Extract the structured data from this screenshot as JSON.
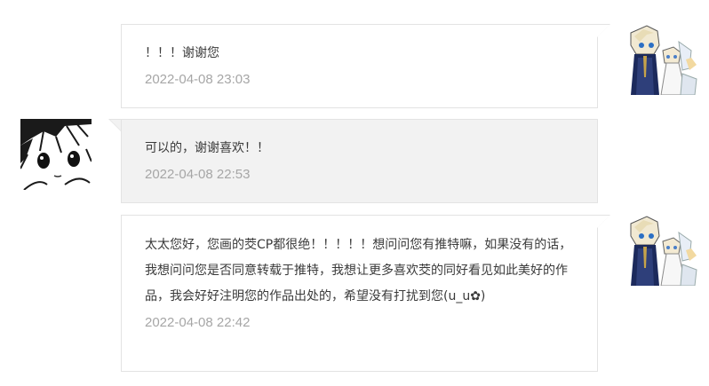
{
  "messages": [
    {
      "direction": "sent",
      "text": "！！！谢谢您",
      "timestamp": "2022-04-08 23:03"
    },
    {
      "direction": "received",
      "text": "可以的，谢谢喜欢！！",
      "timestamp": "2022-04-08 22:53"
    },
    {
      "direction": "sent",
      "text": "太太您好，您画的茭CP都很绝！！！！！想问问您有推特嘛，如果没有的话，我想问问您是否同意转载于推特，我想让更多喜欢茭的同好看见如此美好的作品，我会好好注明您的作品出处的，希望没有打扰到您(u_u✿)",
      "timestamp": "2022-04-08 22:42"
    }
  ],
  "colors": {
    "border": "#e3e3e3",
    "received_background": "#f2f2f2",
    "sent_background": "#ffffff",
    "message_text": "#3a3a3a",
    "timestamp_text": "#a6a6a6"
  }
}
